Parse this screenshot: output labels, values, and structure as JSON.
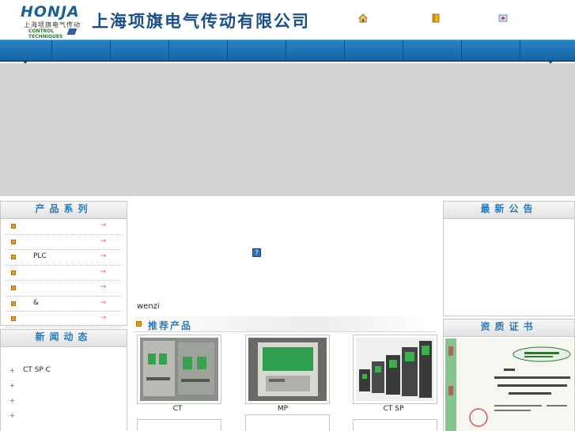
{
  "header": {
    "logo_text": "HONJA",
    "logo_sub": "上海项旗电气传动",
    "logo_ct": "CONTROL TECHNIQUES",
    "company_name": "上海项旗电气传动有限公司"
  },
  "nav": {
    "items": [
      "",
      "",
      "",
      "",
      "",
      "",
      "",
      "",
      "",
      ""
    ]
  },
  "product_series": {
    "title": "产品系列",
    "items": [
      {
        "label": "",
        "arrow": "→"
      },
      {
        "label": "",
        "arrow": "→"
      },
      {
        "label": "PLC",
        "arrow": "→"
      },
      {
        "label": "",
        "arrow": "→"
      },
      {
        "label": "",
        "arrow": "→"
      },
      {
        "label": "&",
        "arrow": "→"
      },
      {
        "label": "",
        "arrow": "→"
      }
    ]
  },
  "news": {
    "title": "新闻动态",
    "items": [
      {
        "label": "CT   SP   C"
      },
      {
        "label": ""
      },
      {
        "label": ""
      },
      {
        "label": ""
      }
    ]
  },
  "announcements": {
    "title": "最新公告"
  },
  "certificates": {
    "title": "资质证书"
  },
  "center": {
    "wenzi": "wenzi",
    "recommended_title": "推荐产品",
    "products": [
      {
        "caption": "CT"
      },
      {
        "caption": "MP"
      },
      {
        "caption": "CT SP"
      }
    ]
  },
  "colors": {
    "nav_blue": "#1f73b5",
    "heading_blue": "#2b78b8",
    "banner_gray": "#d4d4d4",
    "brand_green": "#2a7a2a"
  },
  "icons": [
    "home-icon",
    "bookmark-icon",
    "favorite-icon",
    "flash-placeholder-icon",
    "bullet-icon",
    "arrow-right-icon"
  ]
}
